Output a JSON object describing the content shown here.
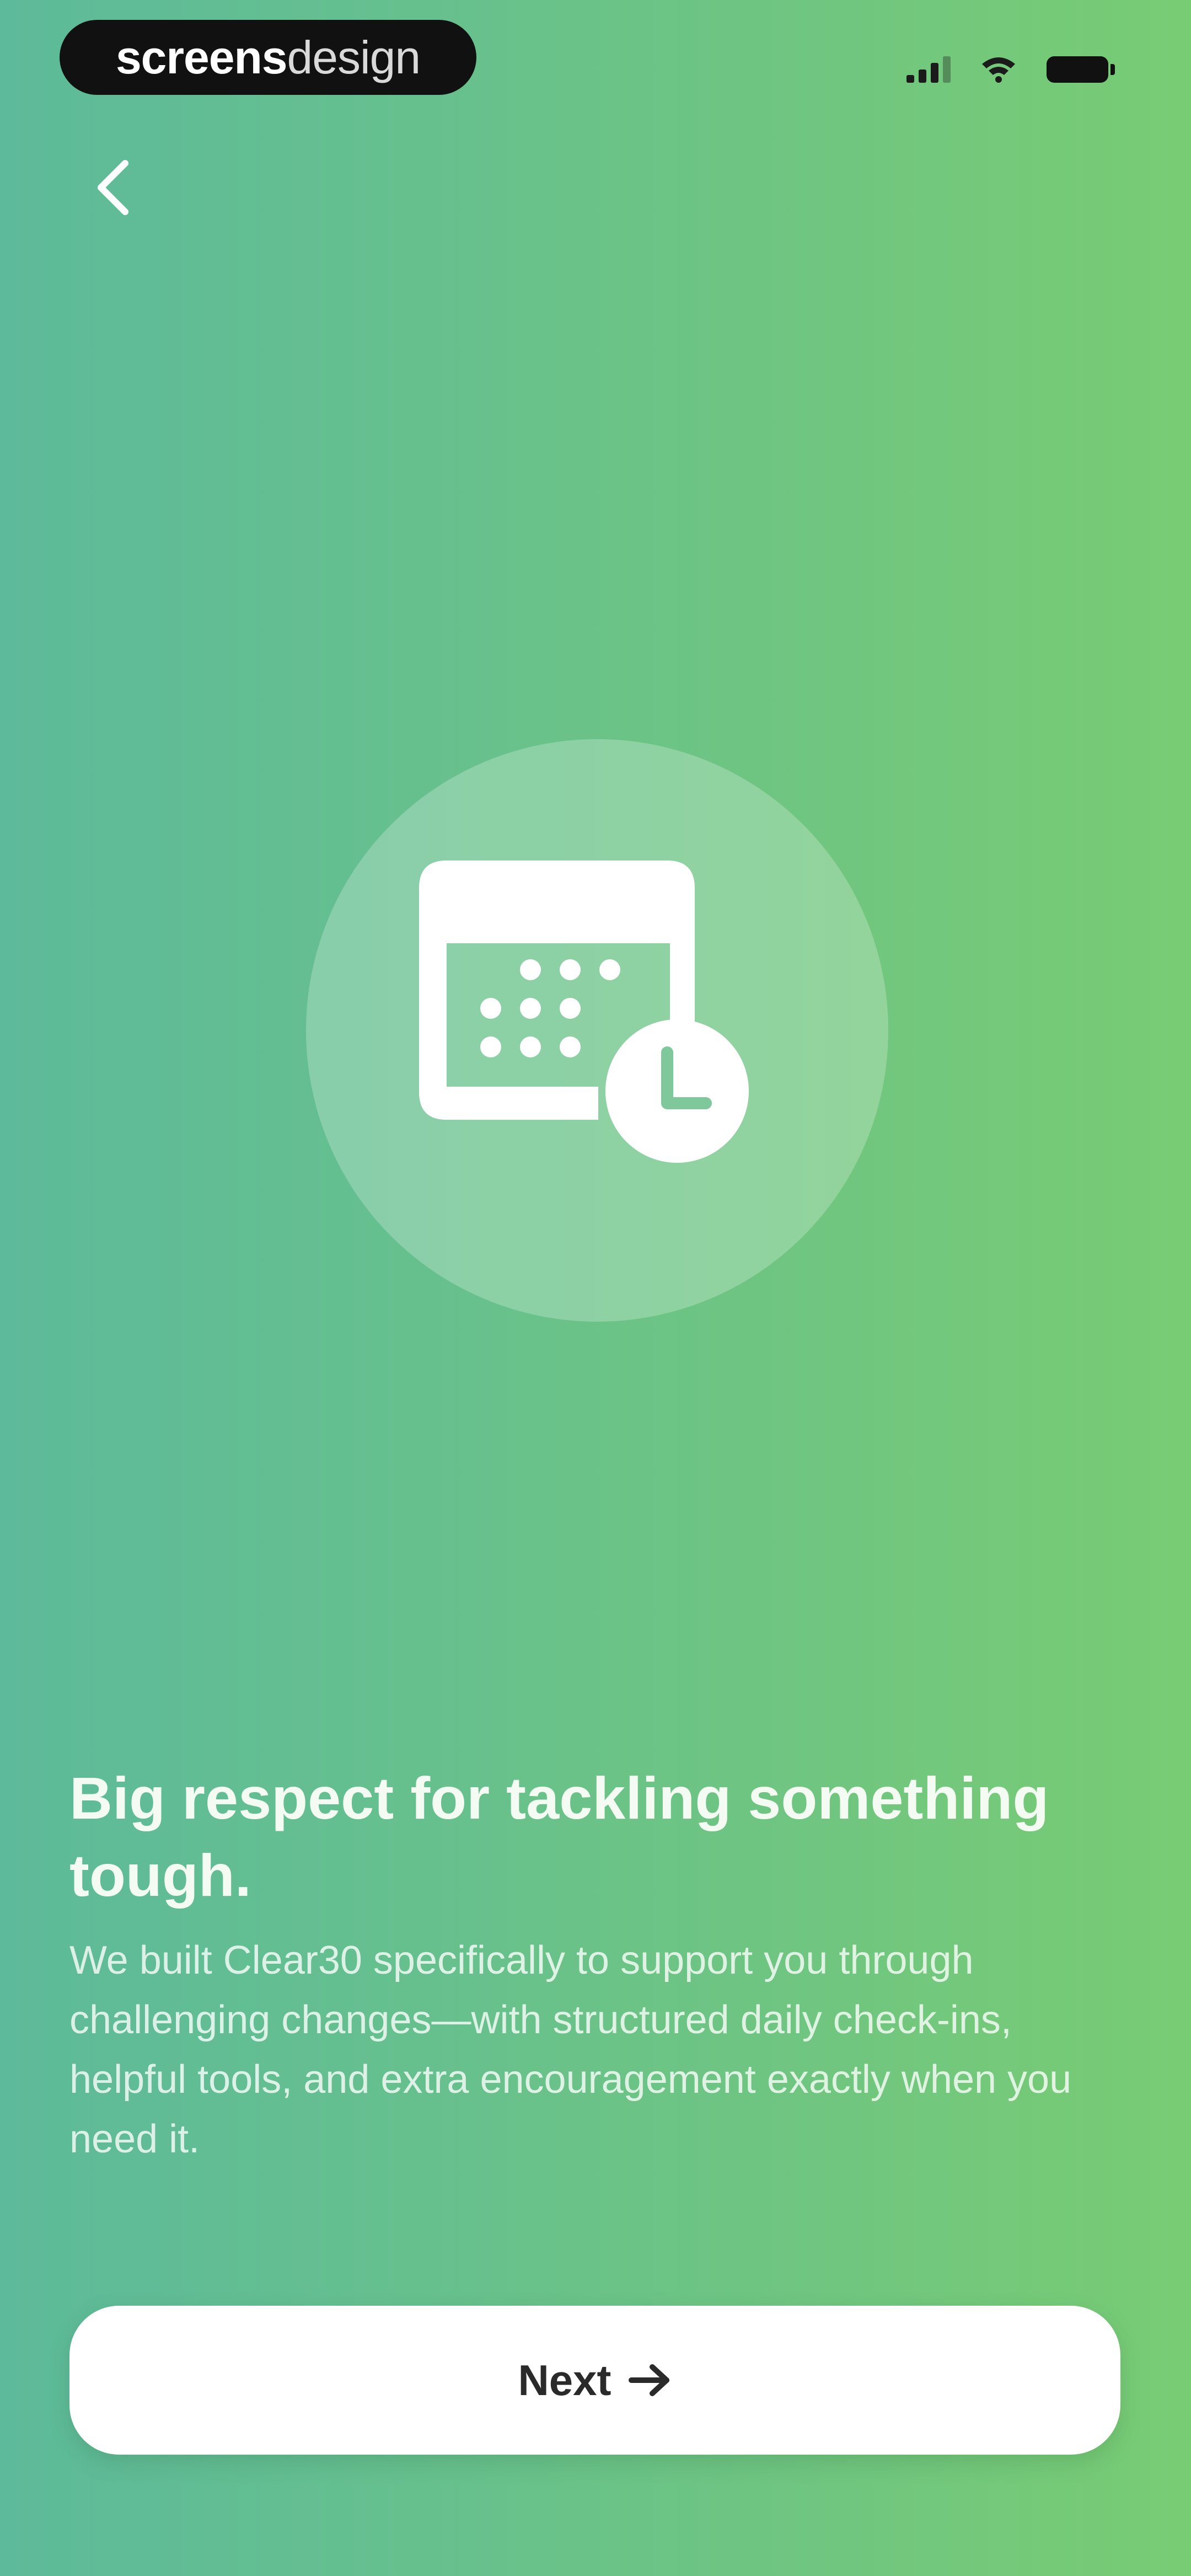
{
  "status_bar": {
    "brand_bold": "screens",
    "brand_light": "design",
    "signal_icon": "cellular-signal-icon",
    "wifi_icon": "wifi-icon",
    "battery_icon": "battery-icon"
  },
  "nav": {
    "back_icon": "chevron-left-icon"
  },
  "hero": {
    "icon": "calendar-clock-icon"
  },
  "content": {
    "headline": "Big respect for tackling something tough.",
    "body": "We built Clear30 specifically to support you through challenging changes—with structured daily check-ins, helpful tools, and extra encouragement exactly when you need it."
  },
  "cta": {
    "label": "Next",
    "icon": "arrow-right-icon"
  },
  "colors": {
    "gradient_start": "#5dba9a",
    "gradient_end": "#78cc74",
    "button_bg": "#ffffff",
    "button_text": "#2a2a2a"
  }
}
